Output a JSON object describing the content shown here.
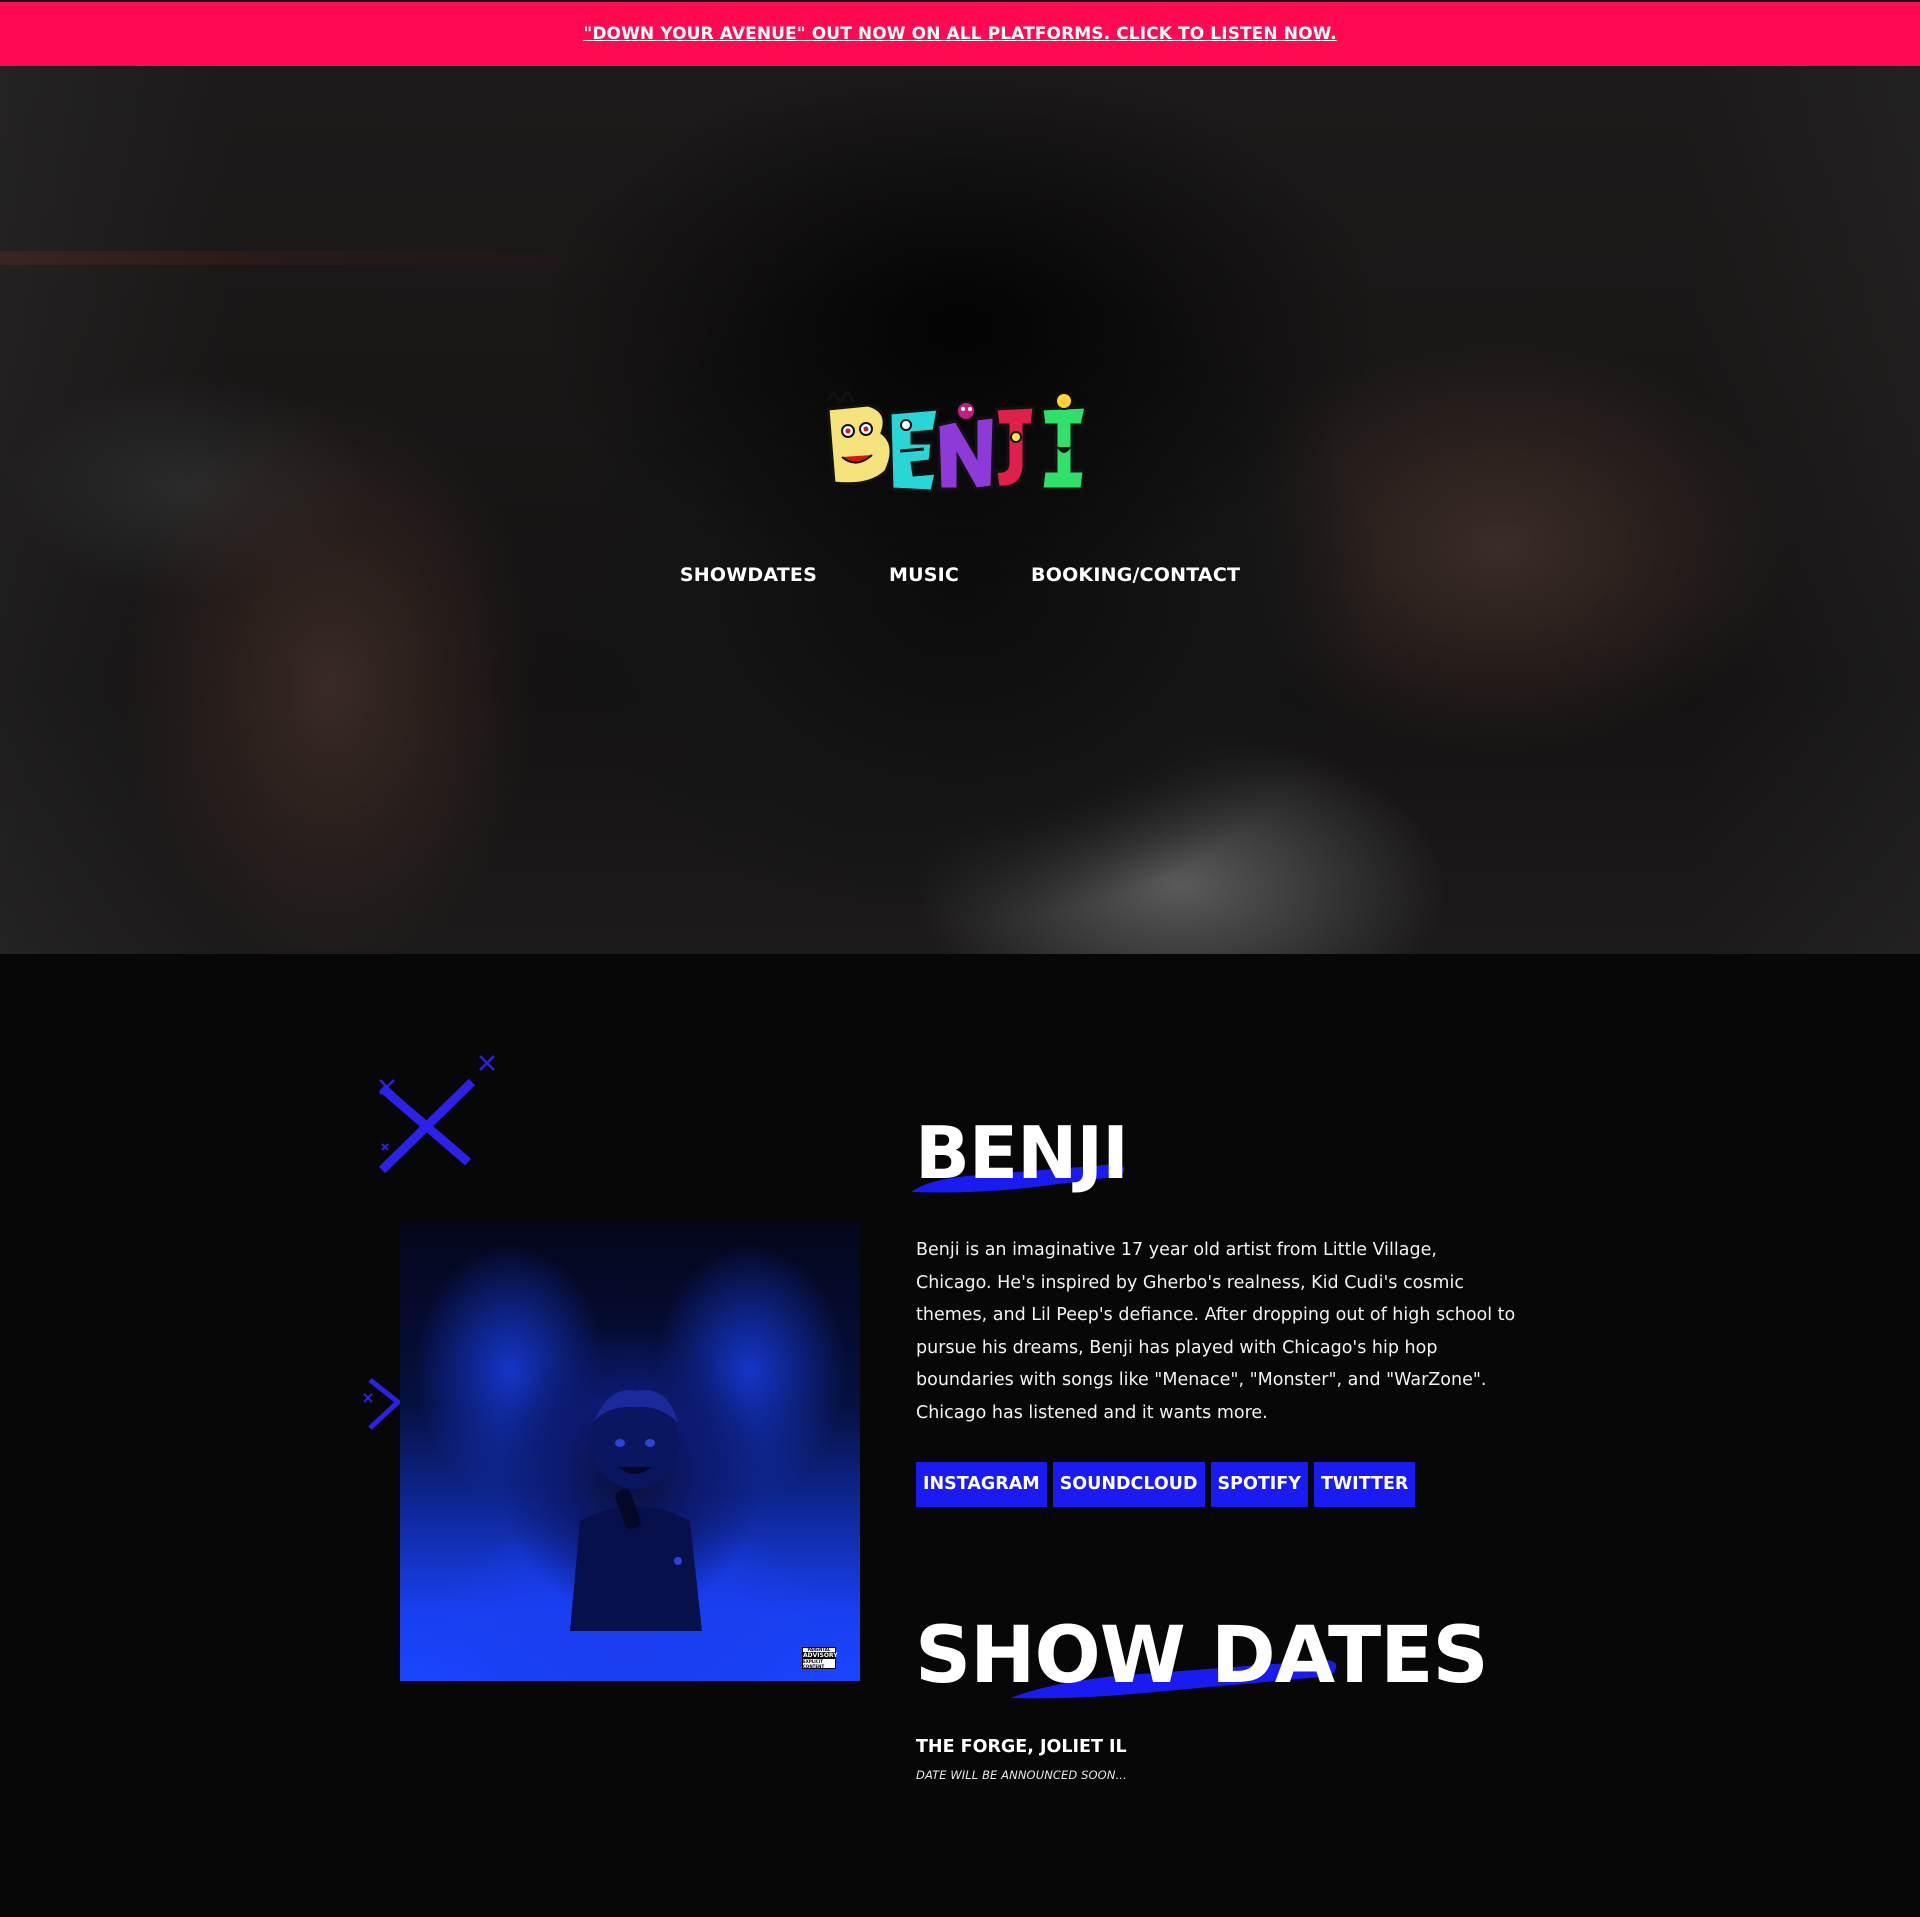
{
  "banner": {
    "text": "\"DOWN YOUR AVENUE\" OUT NOW ON ALL PLATFORMS. CLICK TO LISTEN NOW.",
    "color": "#ff0a50"
  },
  "header": {
    "logo_text": "BENJI",
    "nav": [
      {
        "label": "SHOWDATES"
      },
      {
        "label": "MUSIC"
      },
      {
        "label": "BOOKING/CONTACT"
      }
    ]
  },
  "about": {
    "title": "BENJI",
    "bio": "Benji is an imaginative 17 year old artist from Little Village, Chicago. He's inspired by Gherbo's realness, Kid Cudi's cosmic themes, and Lil Peep's defiance. After dropping out of high school to pursue his dreams, Benji has played with Chicago's hip hop boundaries with songs like \"Menace\", \"Monster\", and \"WarZone\". Chicago has listened and it wants more.",
    "album_advisory": [
      "PARENTAL",
      "ADVISORY",
      "EXPLICIT CONTENT"
    ],
    "socials": [
      {
        "label": "INSTAGRAM"
      },
      {
        "label": "SOUNDCLOUD"
      },
      {
        "label": "SPOTIFY"
      },
      {
        "label": "TWITTER"
      }
    ],
    "accent_color": "#1a1af2"
  },
  "shows": {
    "title": "SHOW DATES",
    "items": [
      {
        "venue": "THE FORGE, JOLIET IL",
        "date": "DATE WILL BE ANNOUNCED SOON..."
      }
    ]
  }
}
